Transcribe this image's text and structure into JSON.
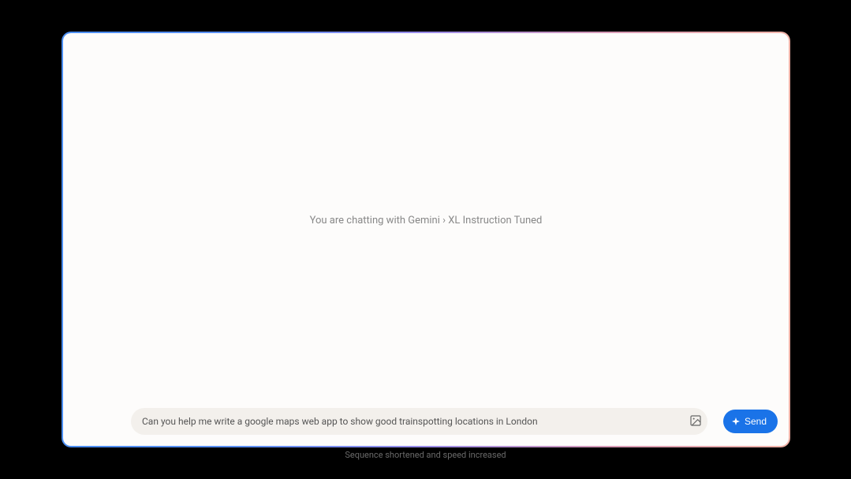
{
  "chat": {
    "status_text": "You are chatting with Gemini › XL Instruction Tuned",
    "input_value": "Can you help me write a google maps web app to show good trainspotting locations in London",
    "send_label": "Send"
  },
  "footer": {
    "disclaimer": "Sequence shortened and speed increased"
  },
  "icons": {
    "image": "image-icon",
    "sparkle": "sparkle-icon"
  }
}
